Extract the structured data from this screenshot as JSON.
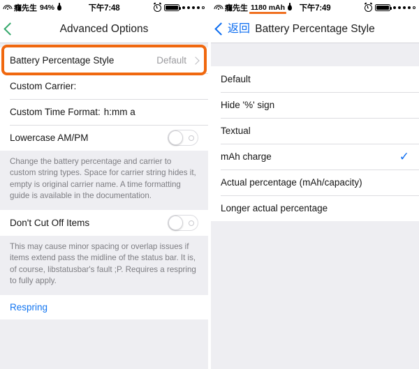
{
  "left_screen": {
    "status_bar": {
      "wifi_icon": "wifi-icon",
      "carrier": "癮先生",
      "battery_text": "94%",
      "drop_icon": "water-drop-icon",
      "time": "下午7:48",
      "alarm_icon": "alarm-clock-icon",
      "battery_icon": "battery-icon",
      "page_dots": "page-dots"
    },
    "nav": {
      "back_icon": "chevron-left-icon",
      "title": "Advanced Options"
    },
    "rows": {
      "battery_percentage_style": {
        "label": "Battery Percentage Style",
        "value": "Default",
        "disclosure_icon": "chevron-right-icon",
        "highlighted": true
      },
      "custom_carrier": {
        "label": "Custom Carrier:",
        "value": ""
      },
      "custom_time_format": {
        "label": "Custom Time Format:",
        "value": "h:mm a"
      },
      "lowercase_ampm": {
        "label": "Lowercase AM/PM",
        "toggle_state": "off"
      },
      "dont_cut_off_items": {
        "label": "Don't Cut Off Items",
        "toggle_state": "off"
      }
    },
    "footers": {
      "first": "Change the battery percentage and carrier to custom string types. Space for carrier string hides it, empty is original carrier name. A time formatting guide is available in the documentation.",
      "second": "This may cause minor spacing or overlap issues if items extend pass the midline of the status bar. It is, of course, libstatusbar's fault ;P. Requires a respring to fully apply."
    },
    "respring": {
      "label": "Respring"
    }
  },
  "right_screen": {
    "status_bar": {
      "wifi_icon": "wifi-icon",
      "carrier": "癮先生",
      "battery_text": "1180 mAh",
      "battery_text_highlighted": true,
      "drop_icon": "water-drop-icon",
      "time": "下午7:49",
      "alarm_icon": "alarm-clock-icon",
      "battery_icon": "battery-icon",
      "page_dots": "page-dots"
    },
    "nav": {
      "back_icon": "chevron-left-icon",
      "back_label": "返回",
      "title": "Battery Percentage Style"
    },
    "options": [
      {
        "label": "Default",
        "selected": false
      },
      {
        "label": "Hide '%' sign",
        "selected": false
      },
      {
        "label": "Textual",
        "selected": false
      },
      {
        "label": "mAh charge",
        "selected": true
      },
      {
        "label": "Actual percentage (mAh/capacity)",
        "selected": false
      },
      {
        "label": "Longer actual percentage",
        "selected": false
      }
    ],
    "checkmark_glyph": "✓"
  },
  "colors": {
    "highlight_orange": "#f0680f",
    "accent_blue": "#0b6cf0",
    "accent_green": "#35a86b",
    "group_bg": "#eeeef2"
  }
}
